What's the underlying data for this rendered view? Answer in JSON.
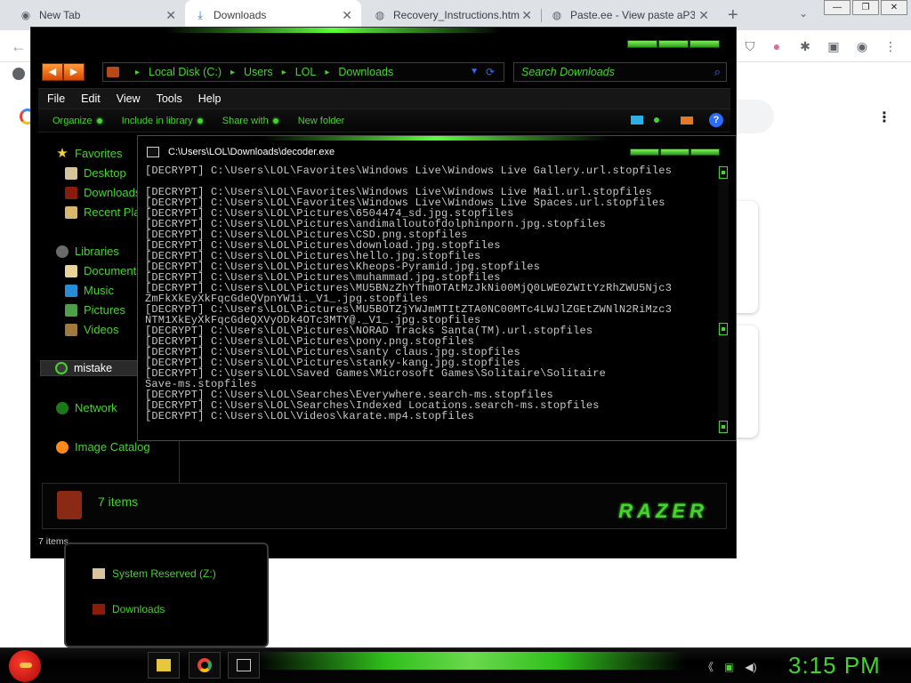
{
  "browser": {
    "tabs": [
      {
        "title": "New Tab",
        "icon": "chrome-icon"
      },
      {
        "title": "Downloads",
        "icon": "download-icon"
      },
      {
        "title": "Recovery_Instructions.htm",
        "icon": "globe-icon"
      },
      {
        "title": "Paste.ee - View paste aP3",
        "icon": "globe-icon"
      }
    ],
    "new_tab_label": "+",
    "tab_close": "✕"
  },
  "explorer": {
    "address": {
      "crumbs": [
        "Local Disk (C:)",
        "Users",
        "LOL",
        "Downloads"
      ]
    },
    "search": {
      "placeholder": "Search Downloads"
    },
    "menu": [
      "File",
      "Edit",
      "View",
      "Tools",
      "Help"
    ],
    "commands": [
      "Organize",
      "Include in library",
      "Share with",
      "New folder"
    ],
    "nav": {
      "favorites": "Favorites",
      "desktop": "Desktop",
      "downloads": "Downloads",
      "recent": "Recent Places",
      "libraries": "Libraries",
      "documents": "Documents",
      "music": "Music",
      "pictures": "Pictures",
      "videos": "Videos",
      "mistake": "mistake",
      "network": "Network",
      "image_catalog": "Image Catalog"
    },
    "details": {
      "count": "7 items",
      "brand": "RAZER"
    },
    "status": "7 items"
  },
  "console": {
    "title": "C:\\Users\\LOL\\Downloads\\decoder.exe",
    "lines": [
      "[DECRYPT] C:\\Users\\LOL\\Favorites\\Windows Live\\Windows Live Gallery.url.stopfiles",
      "",
      "[DECRYPT] C:\\Users\\LOL\\Favorites\\Windows Live\\Windows Live Mail.url.stopfiles",
      "[DECRYPT] C:\\Users\\LOL\\Favorites\\Windows Live\\Windows Live Spaces.url.stopfiles",
      "[DECRYPT] C:\\Users\\LOL\\Pictures\\6504474_sd.jpg.stopfiles",
      "[DECRYPT] C:\\Users\\LOL\\Pictures\\andimalloutofdolphinporn.jpg.stopfiles",
      "[DECRYPT] C:\\Users\\LOL\\Pictures\\CSD.png.stopfiles",
      "[DECRYPT] C:\\Users\\LOL\\Pictures\\download.jpg.stopfiles",
      "[DECRYPT] C:\\Users\\LOL\\Pictures\\hello.jpg.stopfiles",
      "[DECRYPT] C:\\Users\\LOL\\Pictures\\Kheops-Pyramid.jpg.stopfiles",
      "[DECRYPT] C:\\Users\\LOL\\Pictures\\muhammad.jpg.stopfiles",
      "[DECRYPT] C:\\Users\\LOL\\Pictures\\MU5BNzZhYThmOTAtMzJkNi00MjQ0LWE0ZWItYzRhZWU5Njc3",
      "ZmFkXkEyXkFqcGdeQVpnYW1i._V1_.jpg.stopfiles",
      "[DECRYPT] C:\\Users\\LOL\\Pictures\\MU5BOTZjYWJmMTItZTA0NC00MTc4LWJlZGEtZWNlN2RiMzc3",
      "NTM1XkEyXkFqcGdeQXVyODk4OTc3MTY@._V1_.jpg.stopfiles",
      "[DECRYPT] C:\\Users\\LOL\\Pictures\\NORAD Tracks Santa(TM).url.stopfiles",
      "[DECRYPT] C:\\Users\\LOL\\Pictures\\pony.png.stopfiles",
      "[DECRYPT] C:\\Users\\LOL\\Pictures\\santy claus.jpg.stopfiles",
      "[DECRYPT] C:\\Users\\LOL\\Pictures\\stanky-kang.jpg.stopfiles",
      "[DECRYPT] C:\\Users\\LOL\\Saved Games\\Microsoft Games\\Solitaire\\Solitaire",
      "Save-ms.stopfiles",
      "[DECRYPT] C:\\Users\\LOL\\Searches\\Everywhere.search-ms.stopfiles",
      "[DECRYPT] C:\\Users\\LOL\\Searches\\Indexed Locations.search-ms.stopfiles",
      "[DECRYPT] C:\\Users\\LOL\\Videos\\karate.mp4.stopfiles"
    ]
  },
  "flyout": {
    "items": [
      "System Reserved (Z:)",
      "Downloads"
    ]
  },
  "taskbar": {
    "clock": "3:15 PM"
  },
  "colors": {
    "accent_green": "#46d32e",
    "glow_green": "#5cff3a",
    "nav_orange": "#ff9a3a",
    "console_text": "#c8c8c8"
  }
}
